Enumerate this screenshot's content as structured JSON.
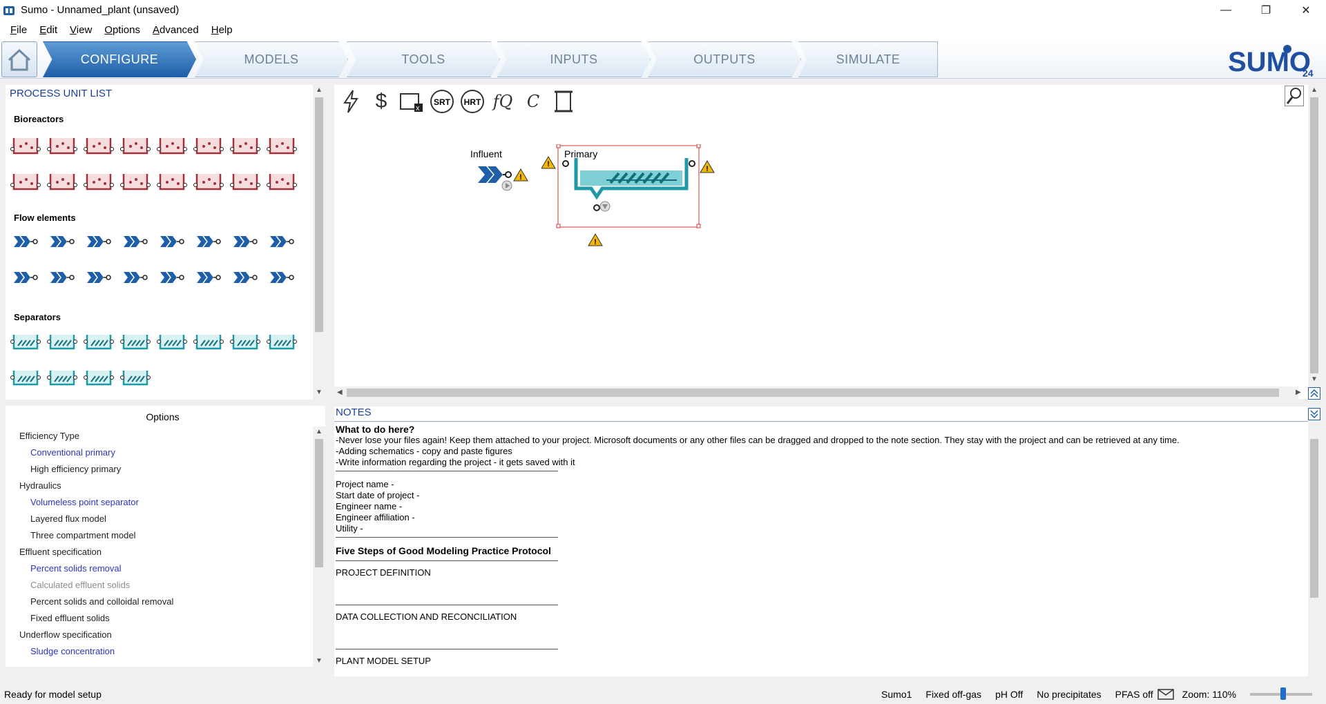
{
  "window": {
    "title": "Sumo - Unnamed_plant (unsaved)"
  },
  "menu": [
    {
      "first": "F",
      "rest": "ile"
    },
    {
      "first": "E",
      "rest": "dit"
    },
    {
      "first": "V",
      "rest": "iew"
    },
    {
      "first": "O",
      "rest": "ptions"
    },
    {
      "first": "A",
      "rest": "dvanced"
    },
    {
      "first": "H",
      "rest": "elp"
    }
  ],
  "tabs": [
    "CONFIGURE",
    "MODELS",
    "TOOLS",
    "INPUTS",
    "OUTPUTS",
    "SIMULATE"
  ],
  "logo": {
    "text": "SUMO",
    "version": "24"
  },
  "process_units": {
    "title": "PROCESS UNIT LIST",
    "sections": [
      "Bioreactors",
      "Flow elements",
      "Separators"
    ]
  },
  "canvas": {
    "tools": [
      "lightning-icon",
      "dollar-icon",
      "table-x-icon",
      "SRT",
      "HRT",
      "fQ",
      "C",
      "scroll-icon"
    ],
    "influent_label": "Influent",
    "primary_label": "Primary"
  },
  "options": {
    "header": "Options",
    "items": [
      {
        "label": "Efficiency Type",
        "level": 1,
        "state": "normal"
      },
      {
        "label": "Conventional primary",
        "level": 2,
        "state": "selected"
      },
      {
        "label": "High efficiency primary",
        "level": 2,
        "state": "normal"
      },
      {
        "label": "Hydraulics",
        "level": 1,
        "state": "normal"
      },
      {
        "label": "Volumeless point separator",
        "level": 2,
        "state": "selected"
      },
      {
        "label": "Layered flux model",
        "level": 2,
        "state": "normal"
      },
      {
        "label": "Three compartment model",
        "level": 2,
        "state": "normal"
      },
      {
        "label": "Effluent specification",
        "level": 1,
        "state": "normal"
      },
      {
        "label": "Percent solids removal",
        "level": 2,
        "state": "selected"
      },
      {
        "label": "Calculated effluent solids",
        "level": 2,
        "state": "disabled"
      },
      {
        "label": "Percent solids and colloidal removal",
        "level": 2,
        "state": "normal"
      },
      {
        "label": "Fixed effluent solids",
        "level": 2,
        "state": "normal"
      },
      {
        "label": "Underflow specification",
        "level": 1,
        "state": "normal"
      },
      {
        "label": "Sludge concentration",
        "level": 2,
        "state": "selected"
      }
    ]
  },
  "notes": {
    "title": "NOTES",
    "lines": [
      {
        "text": "What to do here?",
        "bold": true
      },
      {
        "text": "-Never lose your files again! Keep them attached to your project. Microsoft documents or any other files can be dragged and dropped to the note section. They stay with the project and can be retrieved at any time.",
        "bold": false
      },
      {
        "text": "-Adding schematics - copy and paste figures",
        "bold": false
      },
      {
        "text": "-Write information regarding the project - it gets saved with it",
        "bold": false
      },
      {
        "text": "Project name -",
        "bold": false
      },
      {
        "text": "Start date of project -",
        "bold": false
      },
      {
        "text": "Engineer name -",
        "bold": false
      },
      {
        "text": "Engineer affiliation -",
        "bold": false
      },
      {
        "text": "Utility -",
        "bold": false
      },
      {
        "text": "Five Steps of Good Modeling Practice Protocol",
        "bold": true
      },
      {
        "text": "PROJECT DEFINITION",
        "bold": false
      },
      {
        "text": "DATA COLLECTION AND RECONCILIATION",
        "bold": false
      },
      {
        "text": "PLANT MODEL SETUP",
        "bold": false
      }
    ]
  },
  "status": {
    "left": "Ready for model setup",
    "items": [
      "Sumo1",
      "Fixed off-gas",
      "pH Off",
      "No precipitates",
      "PFAS off"
    ],
    "zoom": "Zoom: 110%",
    "zoom_level_percent": 110
  },
  "colors": {
    "accent": "#1f5fa8",
    "teal": "#1e9aa6",
    "bioreactor": "#a3313a"
  }
}
